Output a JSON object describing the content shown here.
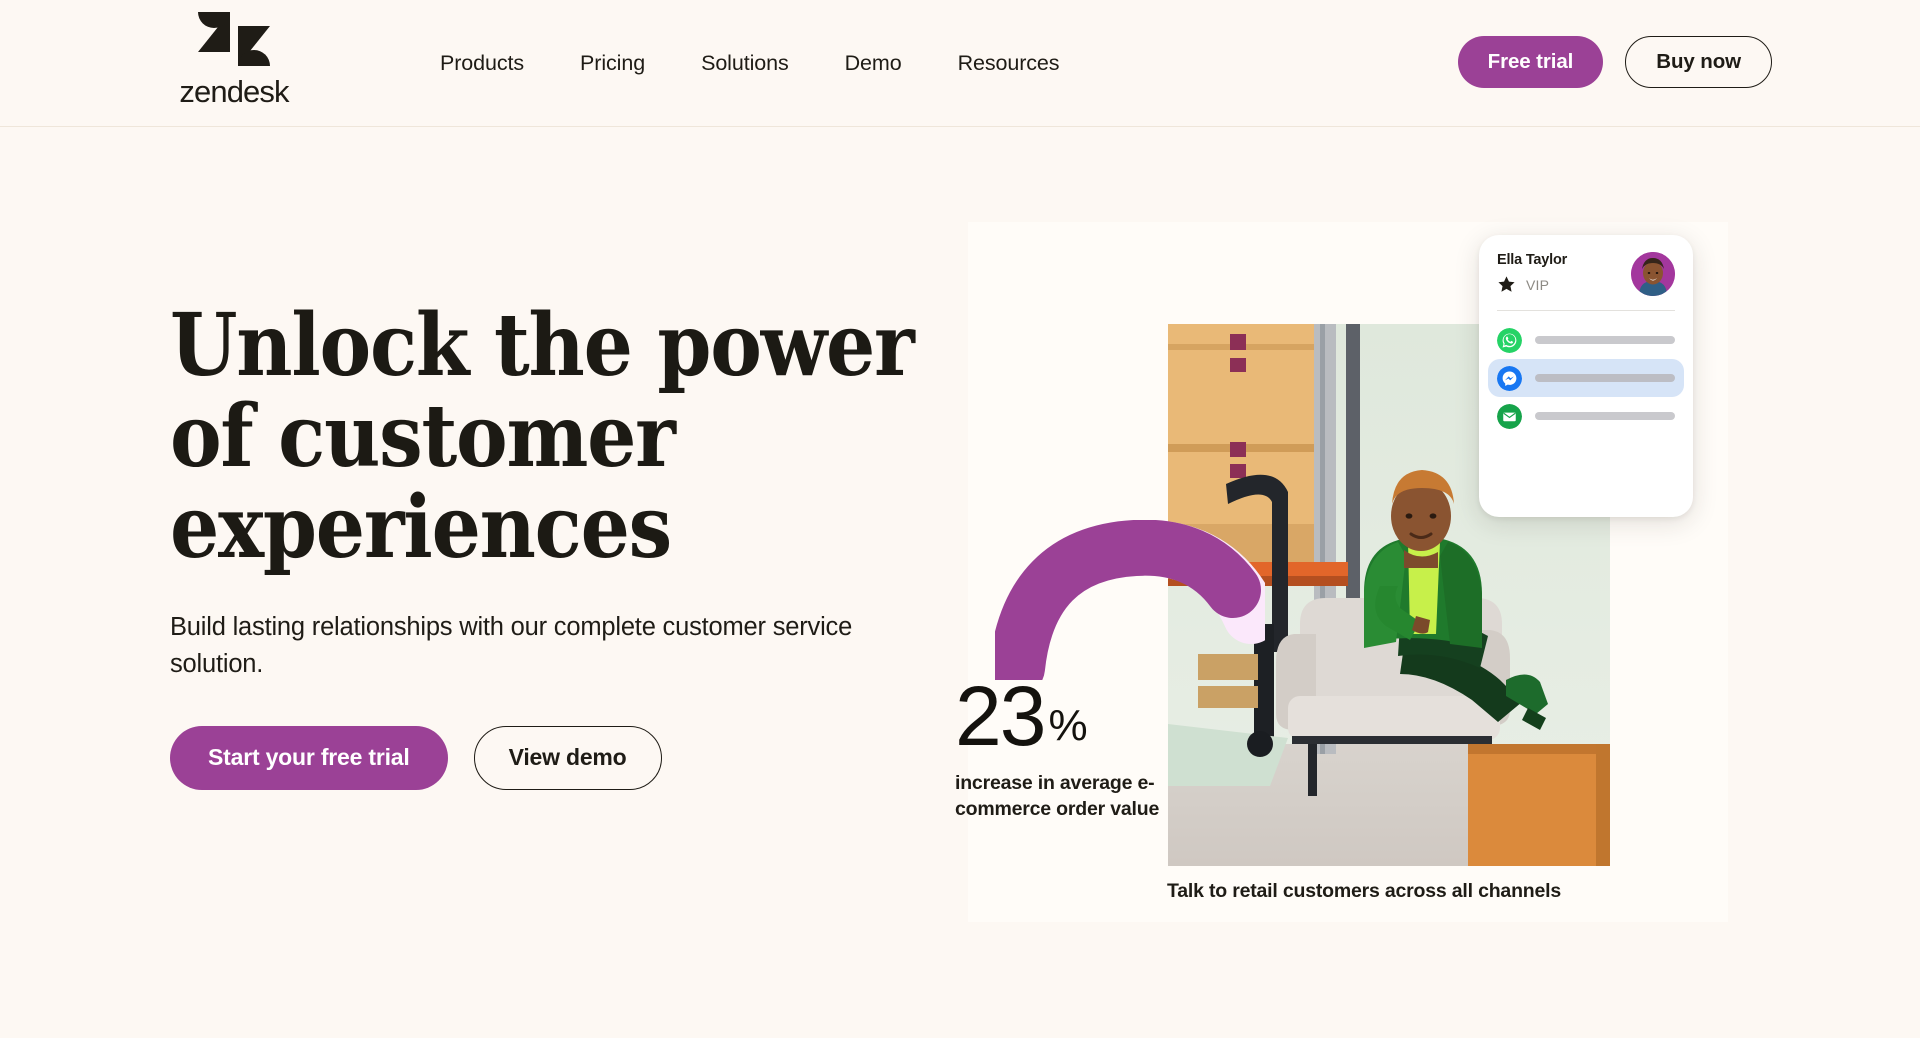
{
  "brand": {
    "name": "zendesk",
    "logo_icon": "zendesk-z-logo",
    "accent_purple": "#9b4196",
    "background": "#fdf8f3",
    "text_dark": "#1f1c16"
  },
  "header": {
    "nav": [
      {
        "label": "Products"
      },
      {
        "label": "Pricing"
      },
      {
        "label": "Solutions"
      },
      {
        "label": "Demo"
      },
      {
        "label": "Resources"
      }
    ],
    "free_trial_label": "Free trial",
    "buy_now_label": "Buy now"
  },
  "hero": {
    "headline_line1": "Unlock the power",
    "headline_line2": "of customer",
    "headline_line3": "experiences",
    "subhead": "Build lasting relationships with our complete customer service solution.",
    "primary_cta": "Start your free trial",
    "secondary_cta": "View demo",
    "photo_caption": "Talk to retail customers across all channels",
    "photo_alt": "Woman in green suit seated in armchair in a warehouse"
  },
  "stat": {
    "number": "23",
    "unit": "%",
    "description": "increase in average e-commerce order value",
    "arc_color": "#9b4196",
    "arc_tail_color": "#fbe8fb"
  },
  "chat_card": {
    "contact_name": "Ella Taylor",
    "badge_icon": "star-icon",
    "badge_label": "VIP",
    "avatar_icon": "avatar-photo",
    "channels": [
      {
        "icon": "whatsapp-icon",
        "color": "#25d366",
        "active": false
      },
      {
        "icon": "messenger-icon",
        "color": "#1877f2",
        "active": true
      },
      {
        "icon": "email-icon",
        "color": "#16a34a",
        "active": false
      }
    ]
  }
}
